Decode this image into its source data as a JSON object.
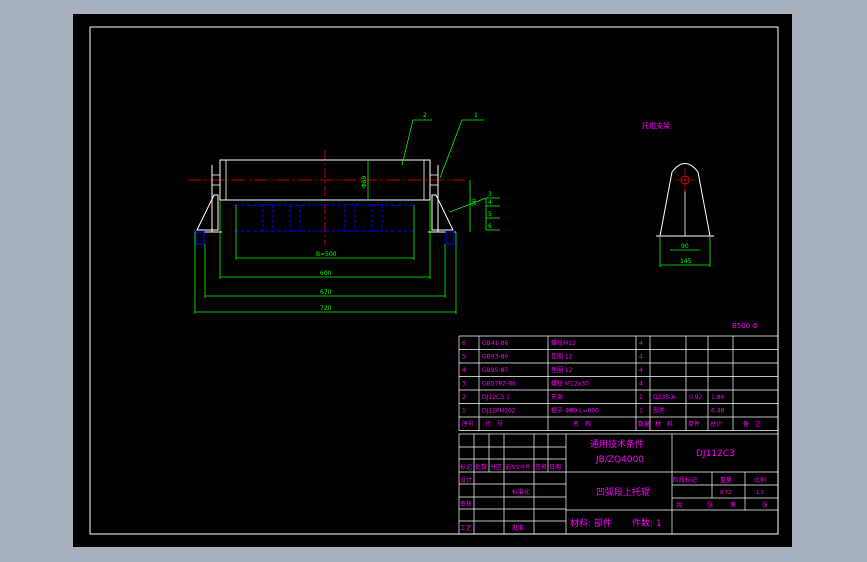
{
  "colors": {
    "viewport": "#a7b0bd",
    "sheet": "#000000",
    "border": "#ffffff",
    "dim": "#00ff00",
    "center": "#ff0000",
    "hidden": "#0000ff",
    "text": "#ff00ff",
    "roller": "#ffffff"
  },
  "drawing": {
    "callouts": [
      "2",
      "1",
      "3",
      "4",
      "5",
      "6"
    ],
    "dims": {
      "diam": "Φ89",
      "span_b": "B=500",
      "d600": "600",
      "d670": "670",
      "d720": "720",
      "h_small": "90",
      "side_90": "90",
      "side_145": "145"
    },
    "side_view_title": "托辊支架",
    "belt_spec": "B500  Φ"
  },
  "bom": {
    "rows": [
      {
        "no": "6",
        "code": "GB41-86",
        "name": "螺母M12",
        "qty": "4",
        "material": "",
        "unit_wt": "",
        "total_wt": "",
        "note": ""
      },
      {
        "no": "5",
        "code": "GB93-86",
        "name": "垫圈 12",
        "qty": "4",
        "material": "",
        "unit_wt": "",
        "total_wt": "",
        "note": ""
      },
      {
        "no": "4",
        "code": "GB95-87",
        "name": "垫圈 12",
        "qty": "4",
        "material": "",
        "unit_wt": "",
        "total_wt": "",
        "note": ""
      },
      {
        "no": "3",
        "code": "GB5782-86",
        "name": "螺栓 M12x30",
        "qty": "4",
        "material": "",
        "unit_wt": "",
        "total_wt": "",
        "note": ""
      },
      {
        "no": "2",
        "code": "DJ12C3.1",
        "name": "支架",
        "qty": "2",
        "material": "Q235-A",
        "unit_wt": "0.92",
        "total_wt": "1.84",
        "note": ""
      },
      {
        "no": "1",
        "code": "DJ12PH102",
        "name": "辊子 Φ89  L=600",
        "qty": "1",
        "material": "部件",
        "unit_wt": "",
        "total_wt": "6.48",
        "note": ""
      }
    ],
    "headers": {
      "no": "序号",
      "code": "代　号",
      "name": "名　称",
      "qty": "数量",
      "material": "材　料",
      "unit_wt": "单件",
      "total_wt": "总计",
      "weight": "重量",
      "note": "备　注"
    }
  },
  "title_block": {
    "std_title": "通用技术条件",
    "std_code": "JB/ZQ4000",
    "drawing_code": "DJ112C3",
    "part_name": "凹弧段上托辊",
    "material_line": "材料: 部件",
    "count_line": "件数: 1",
    "labels": {
      "mark": "标记",
      "count": "处数",
      "zone": "分区",
      "change_doc": "更改文件号",
      "sign": "签名",
      "date": "日期",
      "design": "设计",
      "standardize": "标准化",
      "check": "审核",
      "process": "工艺",
      "approve": "批准",
      "stage_mark": "阶段标记",
      "weight": "重量",
      "scale": "比例",
      "weight_val": "8.72",
      "scale_val": "1:5",
      "sheets_total": "共",
      "sheet": "张",
      "sheet_no": "第",
      "sheet2": "张"
    }
  }
}
